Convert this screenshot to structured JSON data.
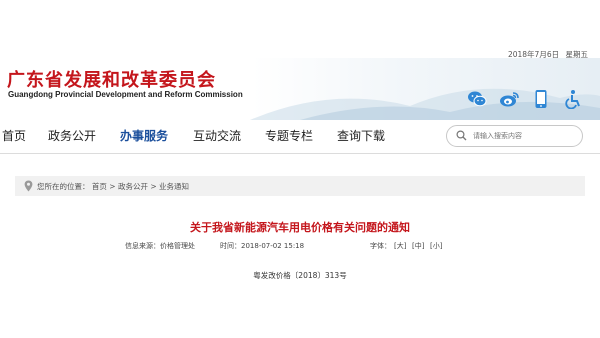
{
  "top_bar": {
    "date": "2018年7月6日",
    "weekday": "星期五"
  },
  "header": {
    "title_cn": "广东省发展和改革委员会",
    "title_en": "Guangdong Provincial Development and Reform Commission",
    "icons": [
      "wechat-icon",
      "weibo-icon",
      "mobile-icon",
      "accessibility-icon"
    ]
  },
  "nav": {
    "items": [
      {
        "label": "首页"
      },
      {
        "label": "政务公开"
      },
      {
        "label": "办事服务"
      },
      {
        "label": "互动交流"
      },
      {
        "label": "专题专栏"
      },
      {
        "label": "查询下载"
      }
    ],
    "active_index": 2,
    "search_placeholder": "请输入搜索内容"
  },
  "breadcrumb": {
    "prefix": "您所在的位置：",
    "items": [
      "首页",
      "政务公开",
      "业务通知"
    ],
    "separator": ">"
  },
  "article": {
    "title": "关于我省新能源汽车用电价格有关问题的通知",
    "source": "信息来源：价格管理处",
    "time": "时间：2018-07-02 15:18",
    "font_label": "字体：",
    "font_sizes": [
      "[大]",
      "[中]",
      "[小]"
    ],
    "doc_number": "粤发改价格〔2018〕313号"
  },
  "colors": {
    "brand_red": "#c4161c",
    "nav_active": "#1b4f9c",
    "icon_blue": "#2f86d4"
  }
}
